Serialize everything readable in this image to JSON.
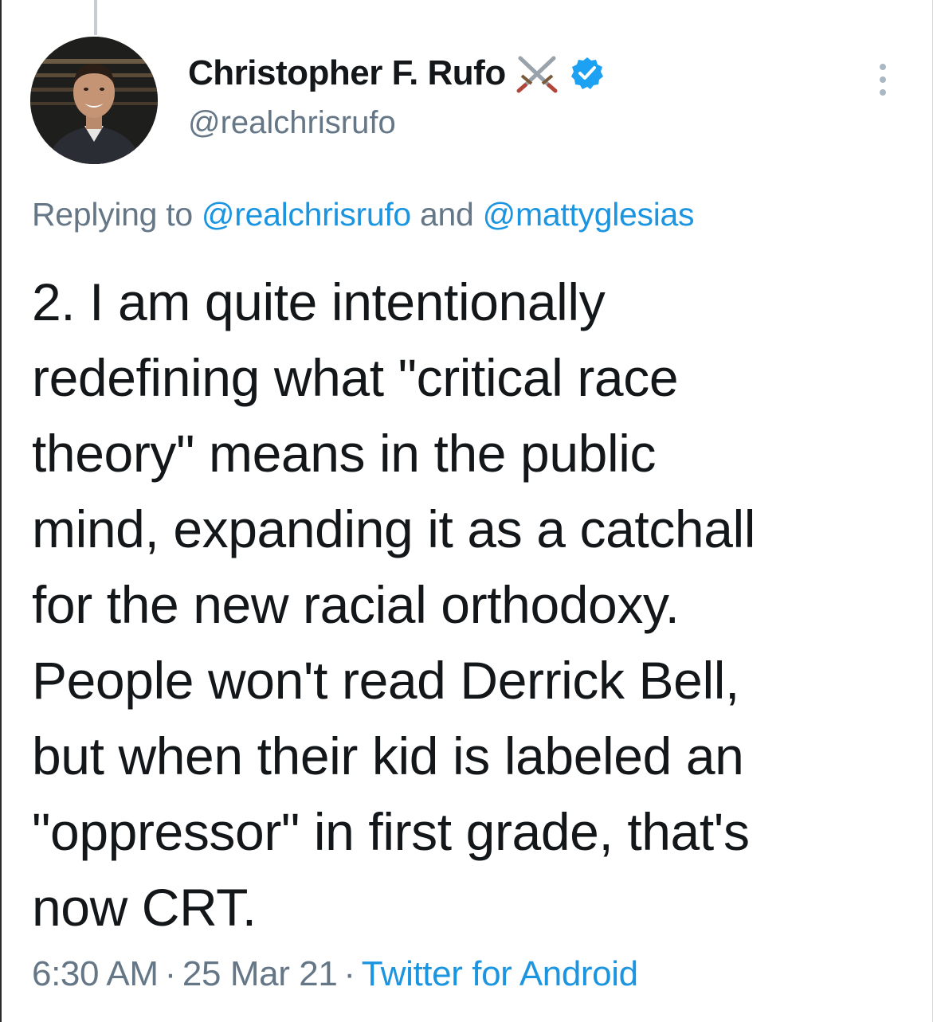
{
  "tweet": {
    "author": {
      "display_name": "Christopher F. Rufo",
      "handle": "@realchrisrufo",
      "badge_icons": [
        "crossed-swords-icon",
        "verified-badge-icon"
      ]
    },
    "reply": {
      "prefix": "Replying to ",
      "mention_1": "@realchrisrufo",
      "joiner": " and ",
      "mention_2": "@mattyglesias"
    },
    "text_lines": [
      "2. I am quite intentionally",
      "redefining what \"critical race",
      "theory\" means in the public",
      "mind, expanding it as a catchall",
      "for the new racial orthodoxy.",
      "People won't read Derrick Bell,",
      "but when their kid is labeled an",
      "\"oppressor\" in first grade, that's",
      "now CRT."
    ],
    "meta": {
      "time": "6:30 AM",
      "separator": "·",
      "date": "25 Mar 21",
      "source": "Twitter for Android"
    }
  },
  "colors": {
    "text_primary": "#14171a",
    "text_secondary": "#657786",
    "link": "#1b95e0",
    "verified": "#1da1f2",
    "thread_line": "#c7cdd2"
  },
  "icons": {
    "more": "more-vertical-icon",
    "swords": "crossed-swords-icon",
    "verified": "verified-badge-icon"
  }
}
